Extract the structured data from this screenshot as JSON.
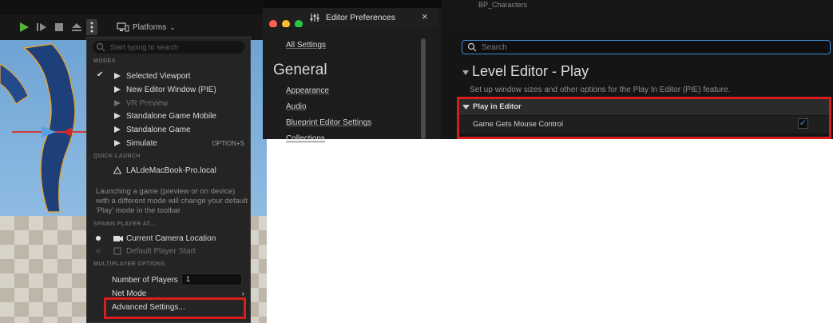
{
  "toolbar": {
    "play_icon": "play-icon",
    "advance_icon": "play-frame-icon",
    "stop_icon": "stop-icon",
    "eject_icon": "eject-icon",
    "more_icon": "vertical-dots-icon",
    "platforms_label": "Platforms"
  },
  "play_menu": {
    "search_placeholder": "Start typing to search",
    "modes_header": "MODES",
    "modes": [
      {
        "label": "Selected Viewport",
        "checked": true,
        "enabled": true
      },
      {
        "label": "New Editor Window (PIE)",
        "enabled": true
      },
      {
        "label": "VR Preview",
        "enabled": false
      },
      {
        "label": "Standalone Game Mobile",
        "enabled": true
      },
      {
        "label": "Standalone Game",
        "enabled": true
      },
      {
        "label": "Simulate",
        "enabled": true,
        "shortcut": "OPTION+S"
      }
    ],
    "quick_launch_header": "QUICK LAUNCH",
    "device": "LALdeMacBook-Pro.local",
    "launch_description": "Launching a game (preview or on device) with a different mode will change your default 'Play' mode in the toolbar",
    "spawn_header": "SPAWN PLAYER AT...",
    "spawn_options": [
      {
        "label": "Current Camera Location",
        "selected": true
      },
      {
        "label": "Default Player Start",
        "selected": false
      }
    ],
    "multiplayer_header": "MULTIPLAYER OPTIONS",
    "number_of_players_label": "Number of Players",
    "number_of_players_value": "1",
    "net_mode_label": "Net Mode",
    "advanced_settings_label": "Advanced Settings..."
  },
  "preferences": {
    "window_title": "Editor Preferences",
    "close_glyph": "×",
    "behind_tab_text": "BP_Characters",
    "all_settings": "All Settings",
    "general_header": "General",
    "nav_items": [
      "Appearance",
      "Audio",
      "Blueprint Editor Settings",
      "Collections"
    ],
    "search_placeholder": "Search",
    "section_title": "Level Editor - Play",
    "section_description": "Set up window sizes and other options for the Play In Editor (PIE) feature.",
    "category": "Play in Editor",
    "setting_label": "Game Gets Mouse Control",
    "setting_checked": true
  },
  "colors": {
    "highlight": "#d81d1d",
    "accent": "#3d8fe8",
    "play_green": "#56b437"
  }
}
